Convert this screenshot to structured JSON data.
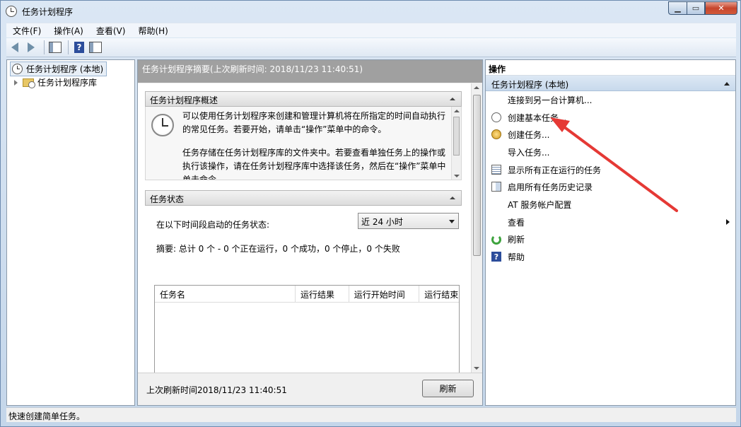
{
  "window": {
    "title": "任务计划程序"
  },
  "menu": [
    "文件(F)",
    "操作(A)",
    "查看(V)",
    "帮助(H)"
  ],
  "tree": {
    "root": "任务计划程序 (本地)",
    "child": "任务计划程序库"
  },
  "center": {
    "header": "任务计划程序摘要(上次刷新时间: 2018/11/23 11:40:51)",
    "overview": {
      "title": "任务计划程序概述",
      "para1": "可以使用任务计划程序来创建和管理计算机将在所指定的时间自动执行的常见任务。若要开始，请单击“操作”菜单中的命令。",
      "para2": "任务存储在任务计划程序库的文件夹中。若要查看单独任务上的操作或执行该操作，请在任务计划程序库中选择该任务，然后在“操作”菜单中单击命令。"
    },
    "status": {
      "title": "任务状态",
      "label": "在以下时间段启动的任务状态:",
      "period": "近 24 小时",
      "summary": "摘要: 总计 0 个 - 0 个正在运行，0 个成功，0 个停止，0 个失败",
      "columns": [
        "任务名",
        "运行结果",
        "运行开始时间",
        "运行结束"
      ]
    },
    "footer": {
      "last_refresh": "上次刷新时间2018/11/23 11:40:51",
      "refresh_button": "刷新"
    }
  },
  "actions": {
    "title": "操作",
    "group": "任务计划程序 (本地)",
    "items": [
      {
        "label": "连接到另一台计算机...",
        "icon": "none"
      },
      {
        "label": "创建基本任务...",
        "icon": "clock-icon"
      },
      {
        "label": "创建任务...",
        "icon": "task-gold-icon"
      },
      {
        "label": "导入任务...",
        "icon": "none"
      },
      {
        "label": "显示所有正在运行的任务",
        "icon": "list-icon"
      },
      {
        "label": "启用所有任务历史记录",
        "icon": "history-icon"
      },
      {
        "label": "AT 服务帐户配置",
        "icon": "none"
      },
      {
        "label": "查看",
        "icon": "none"
      },
      {
        "label": "刷新",
        "icon": "refresh-icon"
      },
      {
        "label": "帮助",
        "icon": "help-icon"
      }
    ]
  },
  "statusbar": {
    "text": "快速创建简单任务。"
  },
  "colors": {
    "annotation_arrow": "#e53935",
    "section_header": "#a0a0a0",
    "accent": "#c8d9ec"
  }
}
